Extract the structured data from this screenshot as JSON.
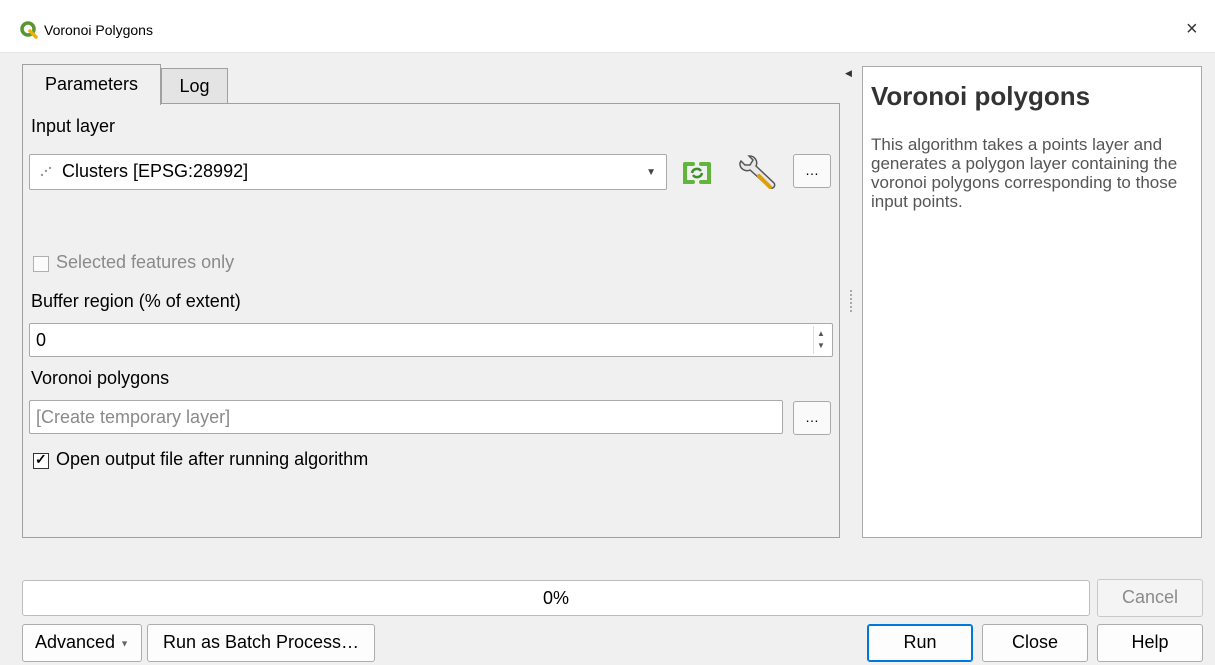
{
  "window": {
    "title": "Voronoi Polygons",
    "close": "×"
  },
  "tabs": [
    {
      "label": "Parameters",
      "active": true
    },
    {
      "label": "Log",
      "active": false
    }
  ],
  "params": {
    "input_layer_label": "Input layer",
    "input_layer_value": "Clusters [EPSG:28992]",
    "selected_only_label": "Selected features only",
    "buffer_label": "Buffer region (% of extent)",
    "buffer_value": "0",
    "output_label": "Voronoi polygons",
    "output_placeholder": "[Create temporary layer]",
    "open_output_label": "Open output file after running algorithm",
    "browse_label": "…",
    "open_output_checked": true,
    "selected_only_checked": false
  },
  "help": {
    "title": "Voronoi polygons",
    "text": "This algorithm takes a points layer and generates a polygon layer containing the voronoi polygons corresponding to those input points."
  },
  "progress": {
    "text": "0%",
    "value": 0
  },
  "buttons": {
    "cancel": "Cancel",
    "advanced": "Advanced",
    "batch": "Run as Batch Process…",
    "run": "Run",
    "close": "Close",
    "help": "Help"
  },
  "colors": {
    "accent": "#0078d7",
    "green_icon": "#5fb63b",
    "logo": "#589632"
  }
}
